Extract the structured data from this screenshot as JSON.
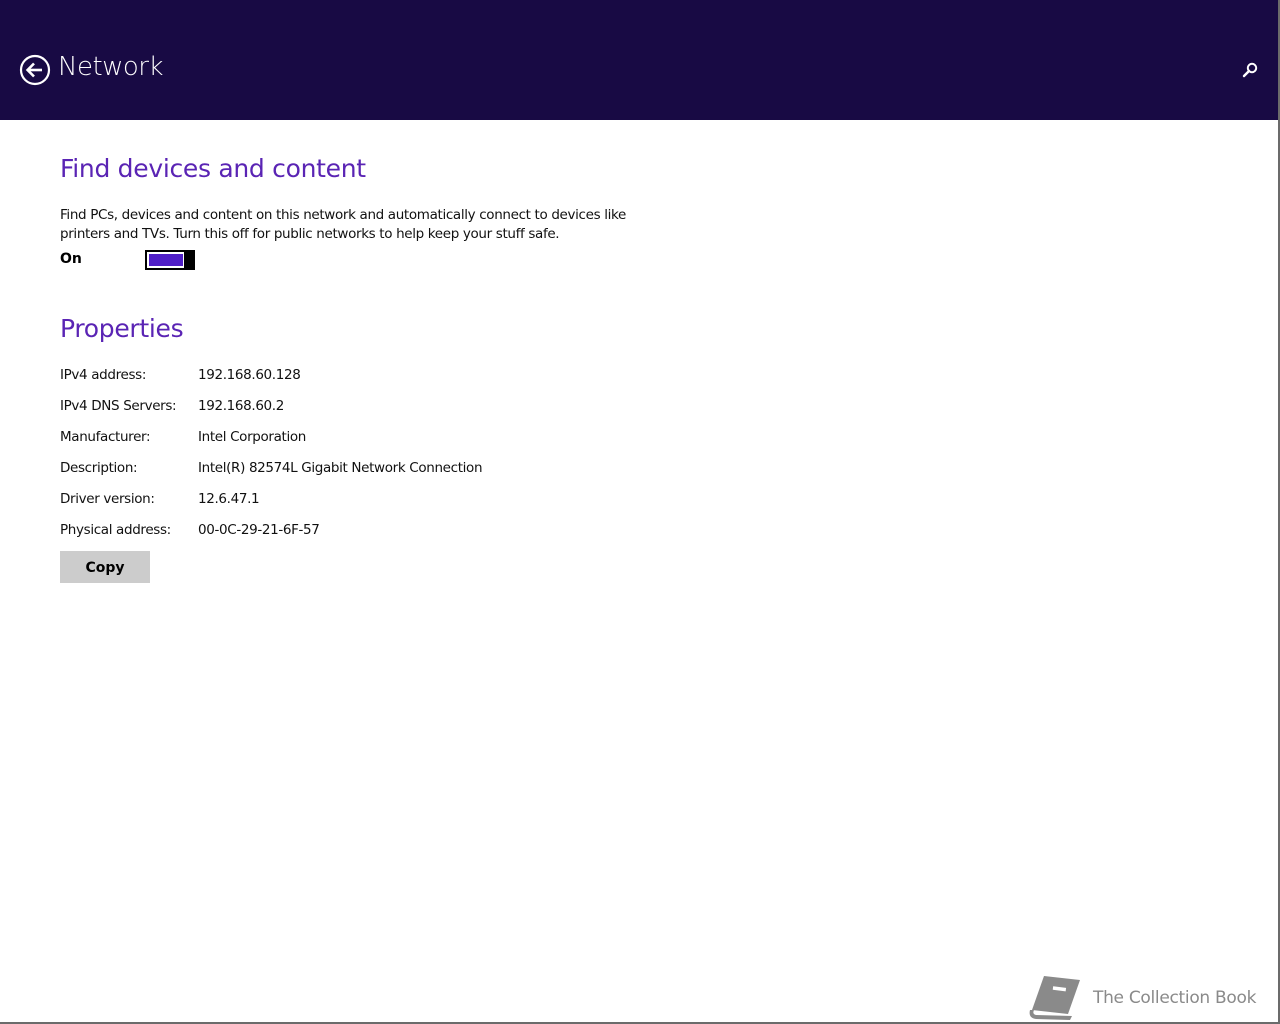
{
  "header": {
    "title": "Network",
    "back_icon": "back-arrow-circle-icon",
    "search_icon": "search-icon",
    "background_color": "#180a44"
  },
  "find_devices": {
    "title": "Find devices and content",
    "description": "Find PCs, devices and content on this network and automatically connect to devices like printers and TVs. Turn this off for public networks to help keep your stuff safe.",
    "toggle_label": "On",
    "toggle_state": "on",
    "accent_color": "#5a24b4"
  },
  "properties": {
    "title": "Properties",
    "rows": [
      {
        "label": "IPv4 address:",
        "value": "192.168.60.128"
      },
      {
        "label": "IPv4 DNS Servers:",
        "value": "192.168.60.2"
      },
      {
        "label": "Manufacturer:",
        "value": "Intel Corporation"
      },
      {
        "label": "Description:",
        "value": "Intel(R) 82574L Gigabit Network Connection"
      },
      {
        "label": "Driver version:",
        "value": "12.6.47.1"
      },
      {
        "label": "Physical address:",
        "value": "00-0C-29-21-6F-57"
      }
    ],
    "copy_label": "Copy"
  },
  "watermark": {
    "icon": "book-icon",
    "text": "The Collection Book"
  }
}
